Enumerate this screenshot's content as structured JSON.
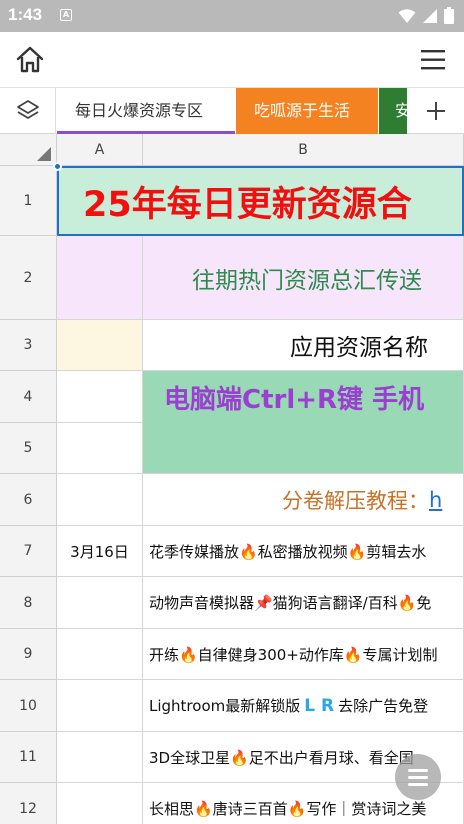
{
  "status_bar": {
    "time": "1:43",
    "app_badge": "A"
  },
  "toolbar": {
    "home_icon": "home-icon",
    "menu_icon": "hamburger-menu-icon"
  },
  "tabs": [
    {
      "label": "每日火爆资源专区",
      "active": true
    },
    {
      "label": "吃呱源于生活",
      "color": "#f58220"
    },
    {
      "label": "安",
      "color": "#2e7d32"
    }
  ],
  "grid": {
    "columns": [
      "A",
      "B"
    ],
    "rows": [
      "1",
      "2",
      "3",
      "4",
      "5",
      "6",
      "7",
      "8",
      "9",
      "10",
      "11",
      "12"
    ],
    "cells": {
      "r1": "25年每日更新资源合",
      "r2": "往期热门资源总汇传送",
      "r3": "应用资源名称",
      "r45": "电脑端Ctrl+R键  手机",
      "r6_label": "分卷解压教程：",
      "r6_link": "h",
      "r7_date": "3月16日",
      "r7": "花季传媒播放🔥私密播放视频🔥剪辑去水",
      "r8": "动物声音模拟器📌猫狗语言翻译/百科🔥免",
      "r9": "开练🔥自律健身300+动作库🔥专属计划制",
      "r10_a": "Lightroom最新解锁版",
      "r10_lr": "L R",
      "r10_b": "去除广告免登",
      "r11": "3D全球卫星🔥足不出户看月球、看全国",
      "r12": "长相思🔥唐诗三百首🔥写作｜赏诗词之美"
    }
  },
  "colors": {
    "title_red": "#f20f0f",
    "title_bg": "#c8eed9",
    "row2_bg": "#f7e6fb",
    "row2_text": "#2f8a4e",
    "row3_bg": "#fdf6e0",
    "row45_bg": "#99d9b6",
    "row45_text": "#9b3fd0",
    "row6_text": "#c8732a",
    "selection_blue": "#1f6fd1"
  }
}
